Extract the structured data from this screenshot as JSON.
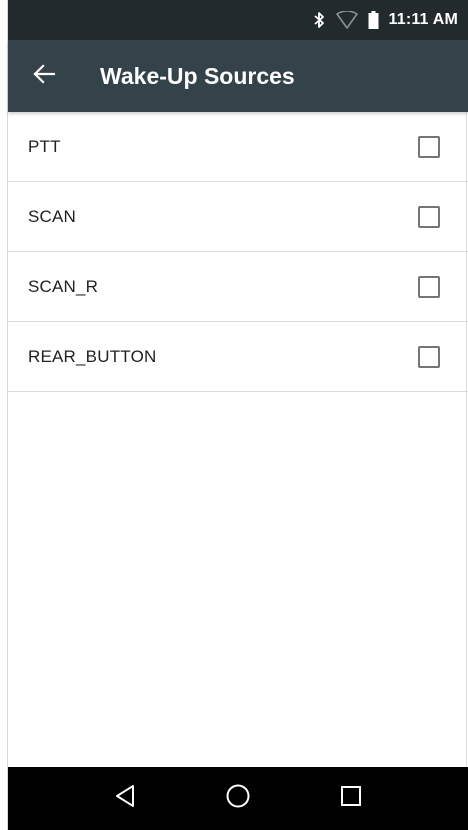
{
  "status_bar": {
    "time": "11:11 AM",
    "icons": [
      "bluetooth-icon",
      "wifi-icon",
      "battery-icon"
    ]
  },
  "app_bar": {
    "title": "Wake-Up Sources",
    "back_icon": "arrow-back-icon"
  },
  "sources": [
    {
      "label": "PTT",
      "checked": false
    },
    {
      "label": "SCAN",
      "checked": false
    },
    {
      "label": "SCAN_R",
      "checked": false
    },
    {
      "label": "REAR_BUTTON",
      "checked": false
    }
  ],
  "nav_bar": {
    "icons": [
      "back-triangle-icon",
      "home-circle-icon",
      "recents-square-icon"
    ]
  },
  "colors": {
    "status_bar": "#232a2e",
    "app_bar": "#34434a",
    "nav_bar": "#000000",
    "text": "#212121",
    "checkbox_border": "#757575",
    "divider": "#dcdcdc"
  }
}
